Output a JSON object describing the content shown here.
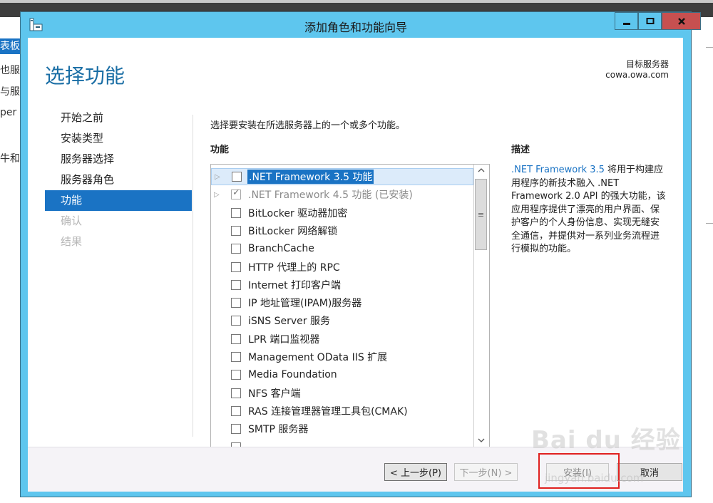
{
  "background": {
    "left_items": [
      "表板",
      "也服",
      "与服",
      "per",
      "牛和"
    ]
  },
  "window": {
    "title": "添加角色和功能向导",
    "icon": "server-manager-icon",
    "controls": {
      "minimize": "minimize-icon",
      "maximize": "maximize-icon",
      "close": "close-icon"
    },
    "colors": {
      "frame": "#5ec6ee",
      "close": "#c75050",
      "accent": "#1a73c4",
      "title_text": "#1a6ea5"
    }
  },
  "header": {
    "page_title": "选择功能",
    "target_label": "目标服务器",
    "target_value": "cowa.owa.com"
  },
  "nav": {
    "items": [
      {
        "label": "开始之前",
        "state": "normal"
      },
      {
        "label": "安装类型",
        "state": "normal"
      },
      {
        "label": "服务器选择",
        "state": "normal"
      },
      {
        "label": "服务器角色",
        "state": "normal"
      },
      {
        "label": "功能",
        "state": "active"
      },
      {
        "label": "确认",
        "state": "disabled"
      },
      {
        "label": "结果",
        "state": "disabled"
      }
    ]
  },
  "main": {
    "instruction": "选择要安装在所选服务器上的一个或多个功能。",
    "features_header": "功能",
    "features": [
      {
        "label": ".NET Framework 3.5 功能",
        "expandable": true,
        "checked": false,
        "selected": true,
        "installed": false
      },
      {
        "label": ".NET Framework 4.5 功能 (已安装)",
        "expandable": true,
        "checked": true,
        "selected": false,
        "installed": true
      },
      {
        "label": "BitLocker 驱动器加密",
        "expandable": false,
        "checked": false
      },
      {
        "label": "BitLocker 网络解锁",
        "expandable": false,
        "checked": false
      },
      {
        "label": "BranchCache",
        "expandable": false,
        "checked": false
      },
      {
        "label": "HTTP 代理上的 RPC",
        "expandable": false,
        "checked": false
      },
      {
        "label": "Internet 打印客户端",
        "expandable": false,
        "checked": false
      },
      {
        "label": "IP 地址管理(IPAM)服务器",
        "expandable": false,
        "checked": false
      },
      {
        "label": "iSNS Server 服务",
        "expandable": false,
        "checked": false
      },
      {
        "label": "LPR 端口监视器",
        "expandable": false,
        "checked": false
      },
      {
        "label": "Management OData IIS 扩展",
        "expandable": false,
        "checked": false
      },
      {
        "label": "Media Foundation",
        "expandable": false,
        "checked": false
      },
      {
        "label": "NFS 客户端",
        "expandable": false,
        "checked": false
      },
      {
        "label": "RAS 连接管理器管理工具包(CMAK)",
        "expandable": false,
        "checked": false
      },
      {
        "label": "SMTP 服务器",
        "expandable": false,
        "checked": false
      }
    ],
    "scrollbar": {
      "up": "^",
      "down": "v",
      "thumb_grip": "≡",
      "position_fraction": 0.0
    },
    "description_header": "描述",
    "description_link": ".NET Framework 3.5",
    "description_text": " 将用于构建应用程序的新技术融入 .NET Framework 2.0 API 的强大功能，该应用程序提供了漂亮的用户界面、保护客户的个人身份信息、实现无缝安全通信，并提供对一系列业务流程进行模拟的功能。"
  },
  "footer": {
    "prev_label": "< 上一步(P)",
    "next_label": "下一步(N) >",
    "install_label": "安装(I)",
    "cancel_label": "取消"
  },
  "watermark": {
    "text": "Bai du 经验",
    "sub": "jingyan.baidu.com"
  }
}
